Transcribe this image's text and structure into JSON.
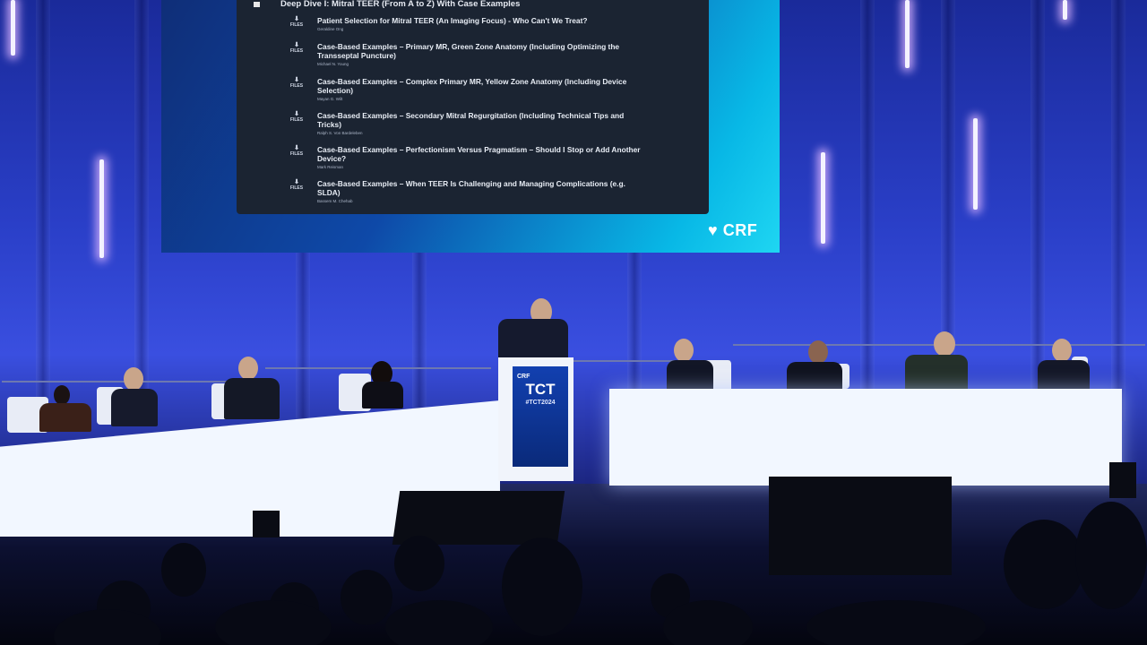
{
  "screen": {
    "section_title": "Deep Dive I: Mitral TEER (From A to Z) With Case Examples",
    "files_label": "FILES",
    "items": [
      {
        "title": "Patient Selection for Mitral TEER (An Imaging Focus) - Who Can't We Treat?",
        "author": "Geraldine Ong"
      },
      {
        "title": "Case-Based Examples – Primary MR, Green Zone Anatomy (Including Optimizing the Transseptal Puncture)",
        "author": "Michael N. Young"
      },
      {
        "title": "Case-Based Examples – Complex Primary MR, Yellow Zone Anatomy (Including Device Selection)",
        "author": "Mayan G. Wilt"
      },
      {
        "title": "Case-Based Examples – Secondary Mitral Regurgitation (Including Technical Tips and Tricks)",
        "author": "Ralph S. Von Bardeleben"
      },
      {
        "title": "Case-Based Examples – Perfectionism Versus Pragmatism – Should I Stop or Add Another Device?",
        "author": "Mark Reisman"
      },
      {
        "title": "Case-Based Examples – When TEER Is Challenging and Managing Complications (e.g. SLDA)",
        "author": "Bassem M. Chehab"
      }
    ],
    "logo": "CRF"
  },
  "podium": {
    "brand": "CRF",
    "event": "TCT",
    "hashtag": "#TCT2024"
  },
  "icons": {
    "download": "download-arrow-icon",
    "checkbox": "checkbox-icon"
  },
  "colors": {
    "stage_blue": "#2a3fc8",
    "screen_cyan": "#1fd6f2",
    "slide_bg": "#1b2432",
    "table_white": "#f2f7ff"
  }
}
